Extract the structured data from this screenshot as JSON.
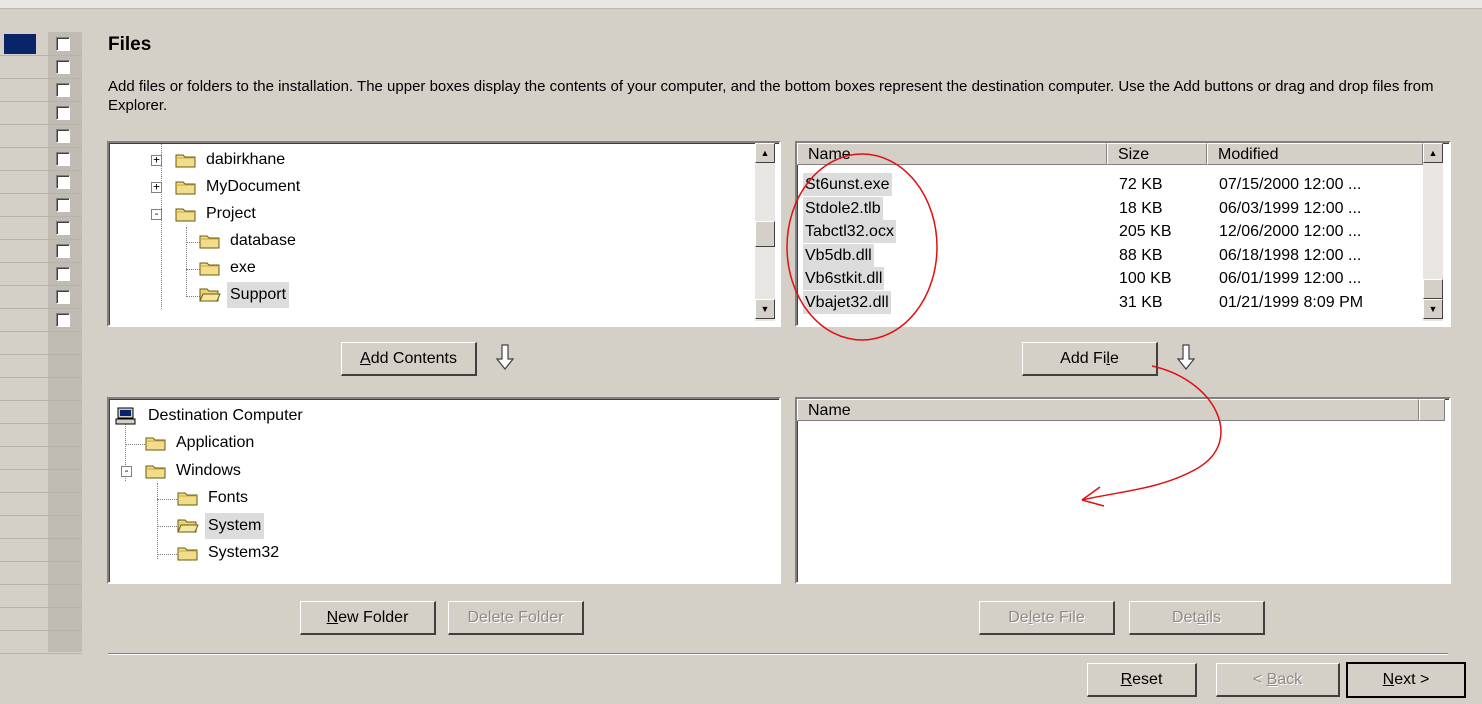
{
  "page": {
    "title": "Files",
    "description": "Add files or folders to the installation. The upper boxes display the contents of your computer, and the bottom boxes represent the destination computer. Use the Add buttons or drag and drop files from Explorer."
  },
  "source_tree": {
    "items": [
      {
        "label": "dabirkhane",
        "expander": "+"
      },
      {
        "label": "MyDocument",
        "expander": "+"
      },
      {
        "label": "Project",
        "expander": "−"
      },
      {
        "label": "database"
      },
      {
        "label": "exe"
      },
      {
        "label": "Support",
        "selected": true
      }
    ]
  },
  "file_list": {
    "columns": [
      "Name",
      "Size",
      "Modified"
    ],
    "rows": [
      {
        "name": "St6unst.exe",
        "size": "72 KB",
        "modified": "07/15/2000 12:00 ..."
      },
      {
        "name": "Stdole2.tlb",
        "size": "18 KB",
        "modified": "06/03/1999 12:00 ..."
      },
      {
        "name": "Tabctl32.ocx",
        "size": "205 KB",
        "modified": "12/06/2000 12:00 ..."
      },
      {
        "name": "Vb5db.dll",
        "size": "88 KB",
        "modified": "06/18/1998 12:00 ..."
      },
      {
        "name": "Vb6stkit.dll",
        "size": "100 KB",
        "modified": "06/01/1999 12:00 ..."
      },
      {
        "name": "Vbajet32.dll",
        "size": "31 KB",
        "modified": "01/21/1999 8:09 PM"
      }
    ]
  },
  "dest_tree": {
    "root": "Destination Computer",
    "items": [
      {
        "label": "Application"
      },
      {
        "label": "Windows",
        "expander": "−"
      },
      {
        "label": "Fonts"
      },
      {
        "label": "System",
        "selected": true
      },
      {
        "label": "System32"
      }
    ]
  },
  "dest_list": {
    "columns": [
      "Name"
    ]
  },
  "buttons": {
    "add_contents": {
      "pre": "",
      "u": "A",
      "post": "dd Contents"
    },
    "add_file": {
      "pre": "Add Fi",
      "u": "l",
      "post": "e"
    },
    "new_folder": {
      "pre": "",
      "u": "N",
      "post": "ew Folder"
    },
    "delete_folder": {
      "pre": "Delete Folder",
      "u": "",
      "post": ""
    },
    "delete_file": {
      "pre": "De",
      "u": "l",
      "post": "ete File"
    },
    "details": {
      "pre": "Det",
      "u": "a",
      "post": "ils"
    },
    "reset": {
      "pre": "",
      "u": "R",
      "post": "eset"
    },
    "back": {
      "pre": "< ",
      "u": "B",
      "post": "ack"
    },
    "next": {
      "pre": "",
      "u": "N",
      "post": "ext >"
    }
  },
  "colors": {
    "accent": "#0a246a",
    "face": "#d4d0c8",
    "annotation": "#e01010",
    "selection": "#dcdcdc"
  }
}
